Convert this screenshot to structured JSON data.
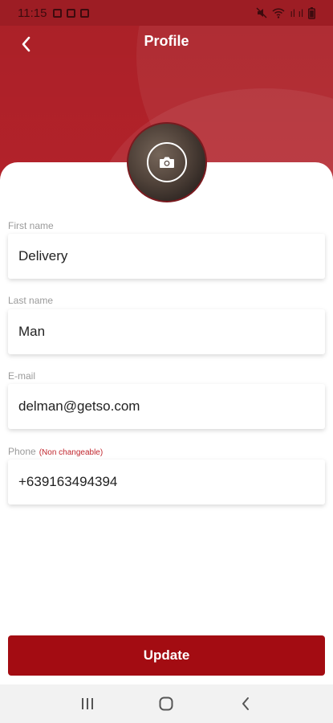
{
  "status_bar": {
    "time": "11:15",
    "signal_text": "ıl ıl"
  },
  "header": {
    "title": "Profile",
    "back_icon": "chevron-left-icon",
    "accent_color": "#b3222a"
  },
  "avatar": {
    "camera_icon": "camera-icon"
  },
  "form": {
    "first_name": {
      "label": "First name",
      "value": "Delivery"
    },
    "last_name": {
      "label": "Last name",
      "value": "Man"
    },
    "email": {
      "label": "E-mail",
      "value": "delman@getso.com"
    },
    "phone": {
      "label": "Phone",
      "note": "(Non changeable)",
      "value": "+639163494394"
    }
  },
  "actions": {
    "update_label": "Update",
    "button_color": "#a30c12"
  },
  "system_nav": {
    "recents_icon": "recents-icon",
    "home_icon": "home-icon",
    "back_icon": "back-icon"
  }
}
